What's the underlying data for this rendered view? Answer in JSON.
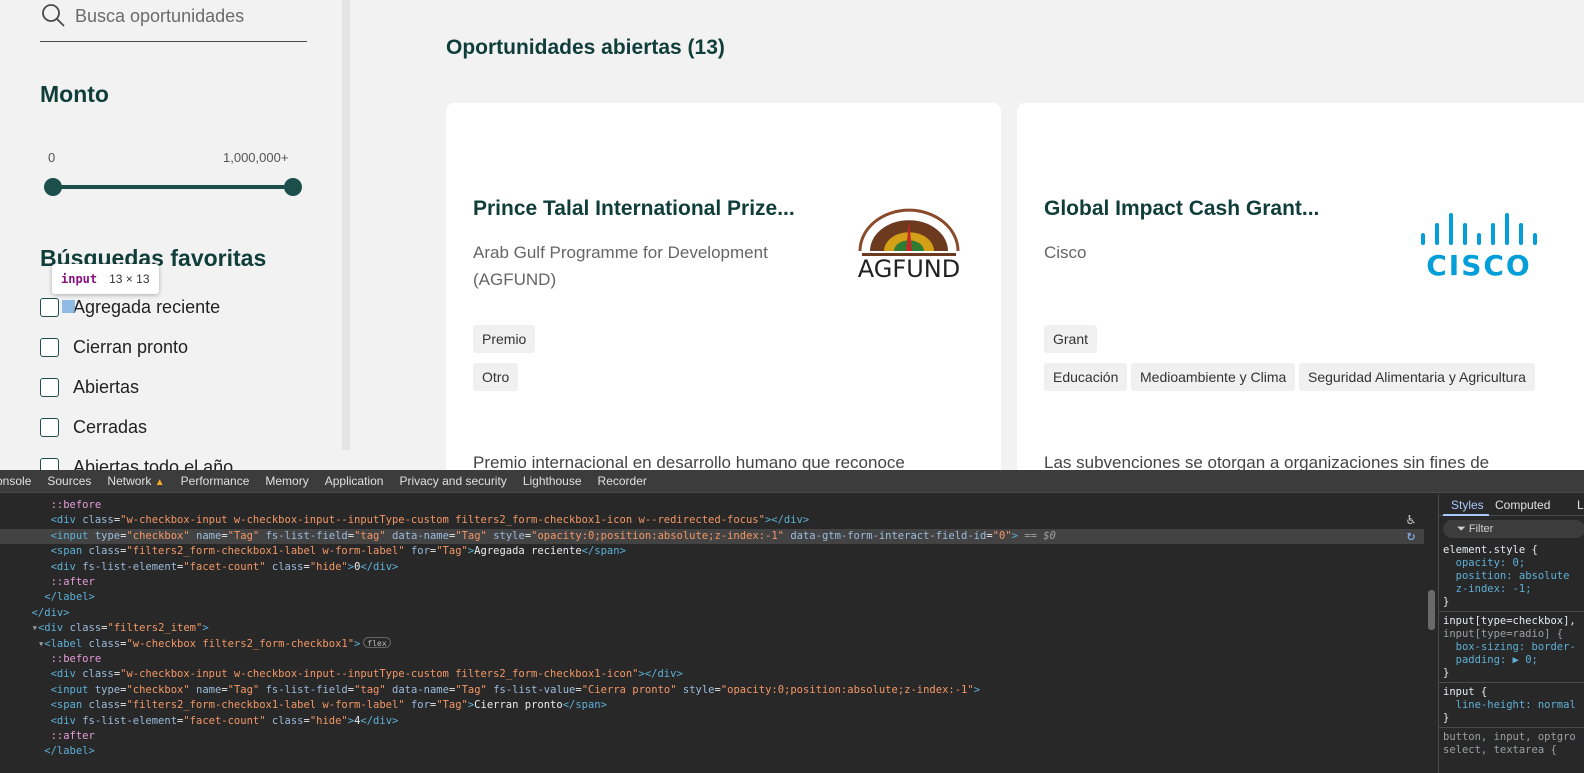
{
  "search": {
    "placeholder": "Busca oportunidades"
  },
  "sidebar": {
    "amount_heading": "Monto",
    "range_min": "0",
    "range_max": "1,000,000+",
    "favorites_heading": "Búsquedas favoritas",
    "checkboxes": [
      {
        "label": "Agregada reciente"
      },
      {
        "label": "Cierran pronto"
      },
      {
        "label": "Abiertas"
      },
      {
        "label": "Cerradas"
      },
      {
        "label": "Abiertas todo el año"
      }
    ]
  },
  "tooltip": {
    "tag": "input",
    "size": "13 × 13"
  },
  "main": {
    "title": "Oportunidades abiertas (13)",
    "cards": [
      {
        "title": "Prince Talal International Prize...",
        "org": "Arab Gulf Programme for Development (AGFUND)",
        "logo_text": "AGFUND",
        "chips": [
          "Premio",
          "Otro"
        ],
        "desc": "Premio internacional en desarrollo humano que reconoce"
      },
      {
        "title": "Global Impact Cash Grant...",
        "org": "Cisco",
        "logo_text": "CISCO",
        "chips": [
          "Grant",
          "Educación",
          "Medioambiente y Clima",
          "Seguridad Alimentaria y Agricultura"
        ],
        "desc": "Las subvenciones se otorgan a organizaciones sin fines de"
      }
    ]
  },
  "devtools": {
    "tabs": [
      "onsole",
      "Sources",
      "Network",
      "Performance",
      "Memory",
      "Application",
      "Privacy and security",
      "Lighthouse",
      "Recorder"
    ],
    "lines": {
      "l1": "::before",
      "l2_tag": "div",
      "l2_attr": "class",
      "l2_val": "\"w-checkbox-input w-checkbox-input--inputType-custom filters2_form-checkbox1-icon w--redirected-focus\"",
      "l3_type": "\"checkbox\"",
      "l3_name": "\"Tag\"",
      "l3_field": "\"tag\"",
      "l3_dname": "\"Tag\"",
      "l3_style": "\"opacity:0;position:absolute;z-index:-1\"",
      "l3_gtm": "\"0\"",
      "l3_eq": " == $0",
      "l4_class": "\"filters2_form-checkbox1-label w-form-label\"",
      "l4_for": "\"Tag\"",
      "l4_text": "Agregada reciente",
      "l5_attr": "\"facet-count\"",
      "l5_class": "\"hide\"",
      "l5_text": "0",
      "l6": "::after",
      "l10_class": "\"filters2_item\"",
      "l11_class": "\"w-checkbox filters2_form-checkbox1\"",
      "l11_badge": "flex",
      "l12": "::before",
      "l13_val": "\"w-checkbox-input w-checkbox-input--inputType-custom filters2_form-checkbox1-icon\"",
      "l14_value": "\"Cierra pronto\"",
      "l14_style": "\"opacity:0;position:absolute;z-index:-1\"",
      "l15_text": "Cierran pronto",
      "l16_text": "4",
      "l17": "::after"
    },
    "styles": {
      "tabs": [
        "Styles",
        "Computed",
        "L"
      ],
      "filter": "Filter",
      "element_style": "element.style {",
      "es_props": [
        "opacity: 0;",
        "position: absolute",
        "z-index: -1;"
      ],
      "rule2_sel1": "input[type=checkbox],",
      "rule2_sel2": "input[type=radio] {",
      "rule2_props": [
        "box-sizing: border-",
        "padding: ▶ 0;"
      ],
      "rule3_sel": "input {",
      "rule3_props": [
        "line-height: normal"
      ],
      "rule4_sel": "button, input, optgro",
      "rule4_sel2": "select, textarea {"
    }
  }
}
